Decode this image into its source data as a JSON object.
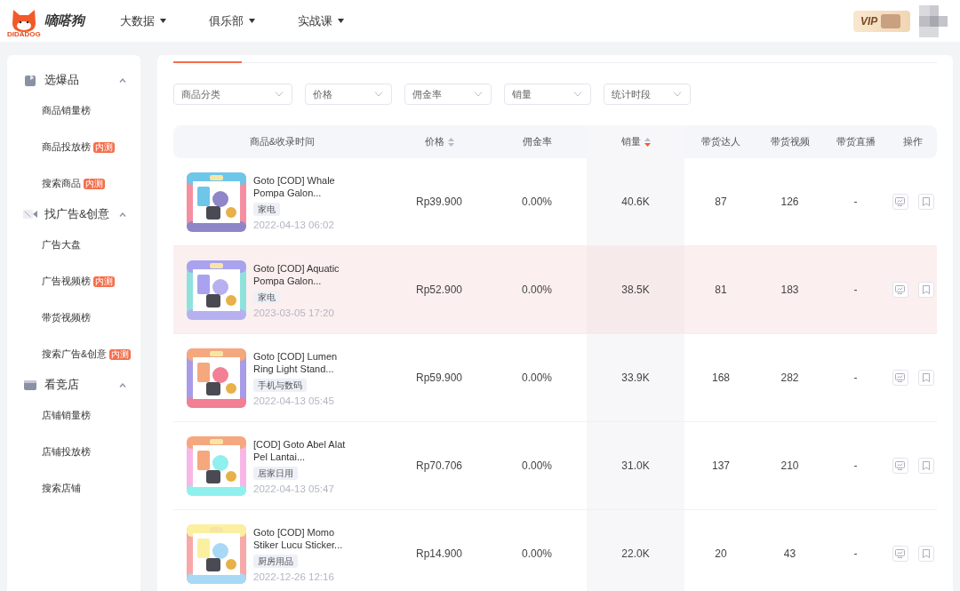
{
  "header": {
    "logo_text": "嘀嗒狗",
    "logo_sub": "DIDADOG",
    "nav": [
      {
        "label": "大数据"
      },
      {
        "label": "俱乐部"
      },
      {
        "label": "实战课"
      }
    ],
    "vip": "VIP"
  },
  "sidebar": {
    "groups": [
      {
        "title": "选爆品",
        "kind": "bag",
        "expanded": true,
        "items": [
          {
            "label": "商品销量榜"
          },
          {
            "label": "商品投放榜",
            "badge": "内测"
          },
          {
            "label": "搜索商品",
            "badge": "内测"
          }
        ]
      },
      {
        "title": "找广告&创意",
        "kind": "video",
        "expanded": true,
        "items": [
          {
            "label": "广告大盘"
          },
          {
            "label": "广告视频榜",
            "badge": "内测"
          },
          {
            "label": "带货视频榜"
          },
          {
            "label": "搜索广告&创意",
            "badge": "内测"
          }
        ]
      },
      {
        "title": "看竞店",
        "kind": "shop",
        "expanded": true,
        "items": [
          {
            "label": "店铺销量榜"
          },
          {
            "label": "店铺投放榜"
          },
          {
            "label": "搜索店铺"
          }
        ]
      }
    ]
  },
  "filters": [
    {
      "placeholder": "商品分类"
    },
    {
      "placeholder": "价格"
    },
    {
      "placeholder": "佣金率"
    },
    {
      "placeholder": "销量"
    },
    {
      "placeholder": "统计时段"
    }
  ],
  "table": {
    "columns": [
      {
        "label": "商品&收录时间"
      },
      {
        "label": "价格",
        "sorted": false
      },
      {
        "label": "佣金率"
      },
      {
        "label": "销量",
        "sorted": true
      },
      {
        "label": "带货达人"
      },
      {
        "label": "带货视频"
      },
      {
        "label": "带货直播"
      },
      {
        "label": "操作"
      }
    ],
    "rows": [
      {
        "highlighted": false,
        "title": "Goto [COD] Whale Pompa Galon...",
        "category": "家电",
        "time": "2022-04-13 06:02",
        "price": "Rp39.900",
        "commission": "0.00%",
        "sales": "40.6K",
        "creators": "87",
        "videos": "126",
        "live": "-"
      },
      {
        "highlighted": true,
        "title": "Goto [COD] Aquatic Pompa Galon...",
        "category": "家电",
        "time": "2023-03-05 17:20",
        "price": "Rp52.900",
        "commission": "0.00%",
        "sales": "38.5K",
        "creators": "81",
        "videos": "183",
        "live": "-"
      },
      {
        "highlighted": false,
        "title": "Goto [COD] Lumen Ring Light Stand...",
        "category": "手机与数码",
        "time": "2022-04-13 05:45",
        "price": "Rp59.900",
        "commission": "0.00%",
        "sales": "33.9K",
        "creators": "168",
        "videos": "282",
        "live": "-"
      },
      {
        "highlighted": false,
        "title": "[COD] Goto Abel Alat Pel Lantai...",
        "category": "居家日用",
        "time": "2022-04-13 05:47",
        "price": "Rp70.706",
        "commission": "0.00%",
        "sales": "31.0K",
        "creators": "137",
        "videos": "210",
        "live": "-"
      },
      {
        "highlighted": false,
        "title": "Goto [COD] Momo Stiker Lucu Sticker...",
        "category": "厨房用品",
        "time": "2022-12-26 12:16",
        "price": "Rp14.900",
        "commission": "0.00%",
        "sales": "22.0K",
        "creators": "20",
        "videos": "43",
        "live": "-"
      }
    ]
  }
}
